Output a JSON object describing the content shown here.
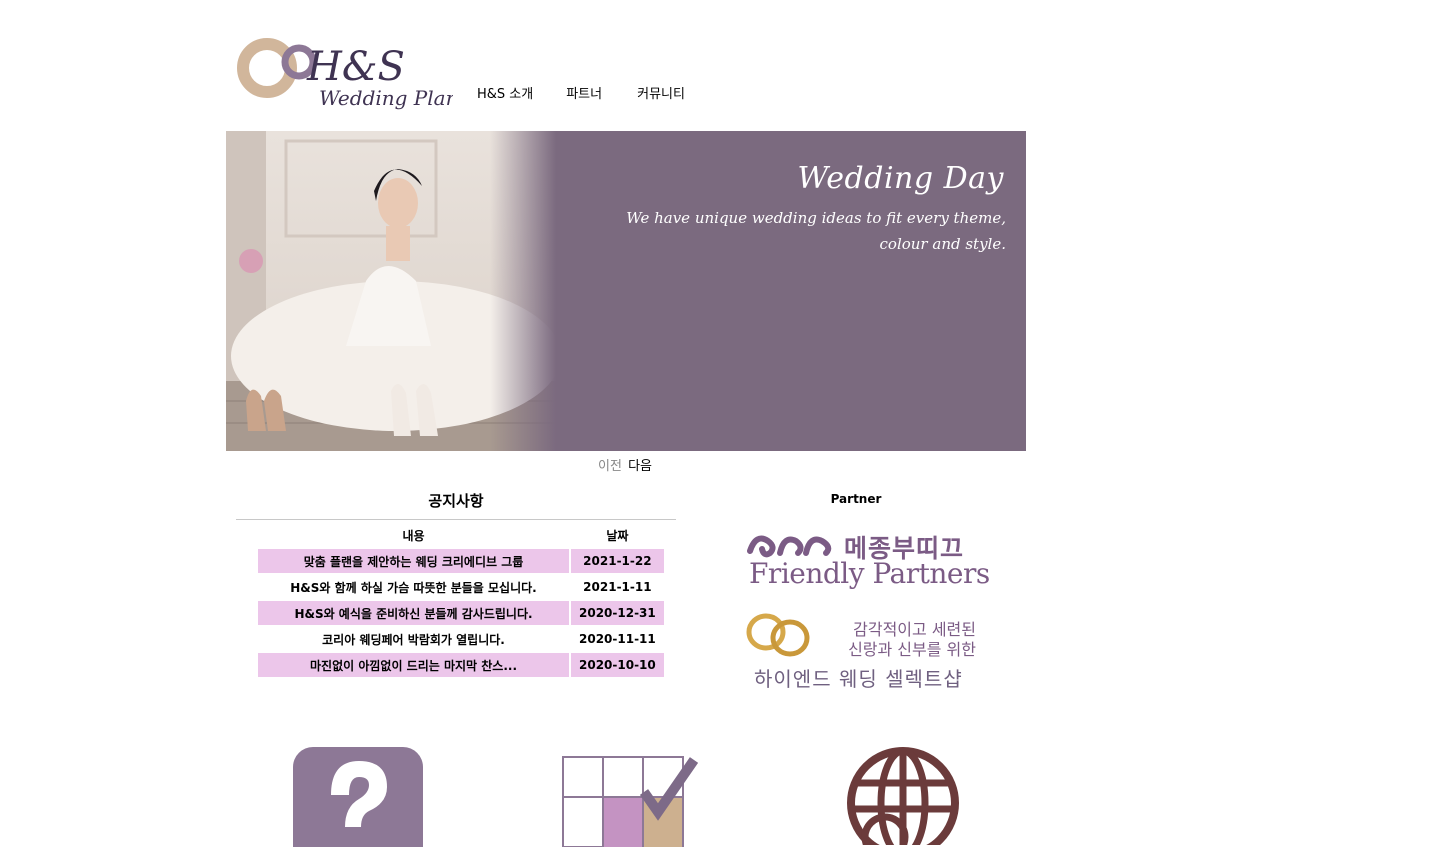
{
  "logo": {
    "monogram": "H&S",
    "tagline": "Wedding Plan"
  },
  "nav": {
    "items": [
      {
        "label": "H&S 소개"
      },
      {
        "label": "파트너"
      },
      {
        "label": "커뮤니티"
      }
    ]
  },
  "banner": {
    "title": "Wedding Day",
    "subtitle_line1": "We have unique wedding ideas to fit every theme,",
    "subtitle_line2": "colour and style.",
    "prev_label": "이전",
    "next_label": "다음"
  },
  "notice": {
    "title": "공지사항",
    "columns": [
      "내용",
      "날짜"
    ],
    "rows": [
      {
        "content": "맞춤 플랜을 제안하는 웨딩 크리에디브 그룹",
        "date": "2021-1-22"
      },
      {
        "content": "H&S와 함께 하실 가슴 따뜻한 분들을 모십니다.",
        "date": "2021-1-11"
      },
      {
        "content": "H&S와 예식을 준비하신 분들께 감사드립니다.",
        "date": "2020-12-31"
      },
      {
        "content": "코리아 웨딩페어 박람회가 열립니다.",
        "date": "2020-11-11"
      },
      {
        "content": "마진없이 아낌없이 드리는 마지막 찬스...",
        "date": "2020-10-10"
      }
    ]
  },
  "partner": {
    "title": "Partner",
    "brand_kr": "메종부띠끄",
    "brand_en": "Friendly Partners",
    "ad_line1": "감각적이고 세련된",
    "ad_line2": "신랑과 신부를 위한",
    "ad_line3": "하이엔드 웨딩 셀렉트샵"
  },
  "icons": {
    "items": [
      "question-icon",
      "checklist-grid-icon",
      "globe-icon"
    ]
  },
  "colors": {
    "banner_bg": "#7b6a7f",
    "row_highlight": "#ecc6ea",
    "accent_purple": "#7b5b85",
    "icon_purple": "#8d7896",
    "icon_brown": "#6b3b3b"
  }
}
